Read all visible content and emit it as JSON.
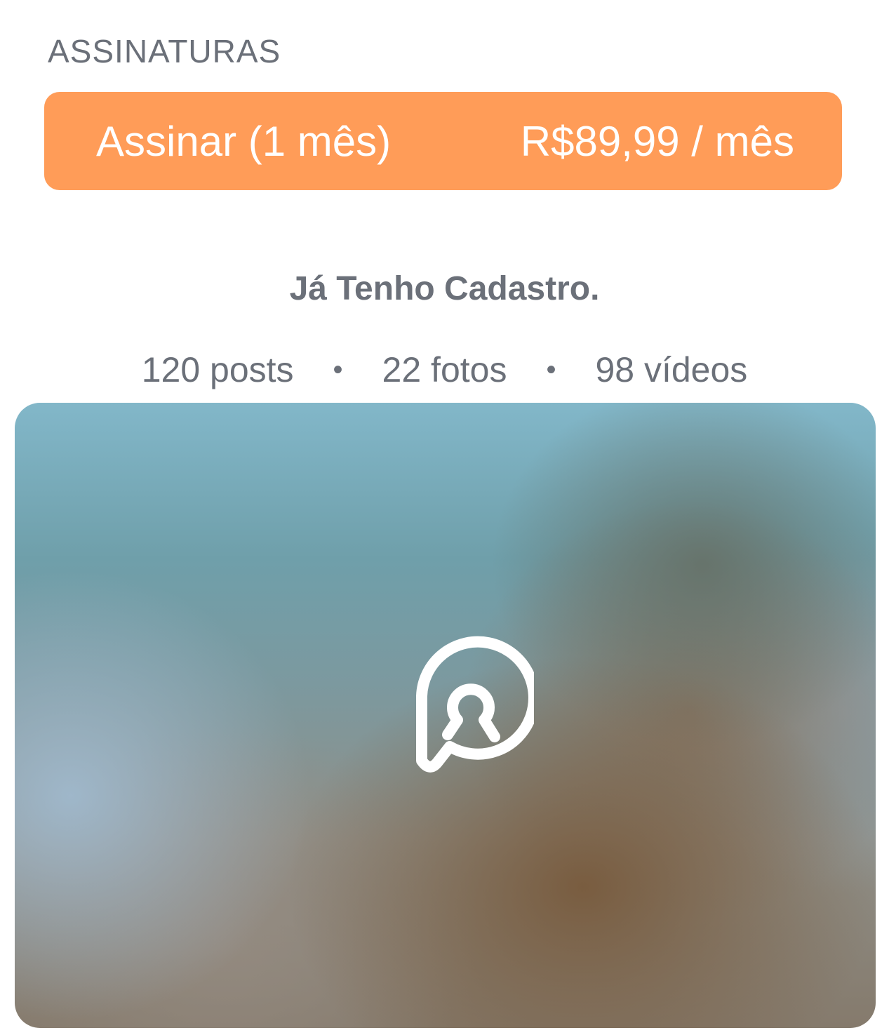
{
  "subscriptions": {
    "section_title": "ASSINATURAS",
    "plan_label": "Assinar (1 mês)",
    "plan_price": "R$89,99 / mês",
    "button_color": "#ff9c58"
  },
  "login": {
    "link_label": "Já Tenho Cadastro."
  },
  "stats": {
    "posts": "120 posts",
    "photos": "22 fotos",
    "videos": "98 vídeos",
    "separator": "•"
  },
  "media_preview": {
    "state": "blurred-locked",
    "icon": "keyhole-lock-icon"
  }
}
